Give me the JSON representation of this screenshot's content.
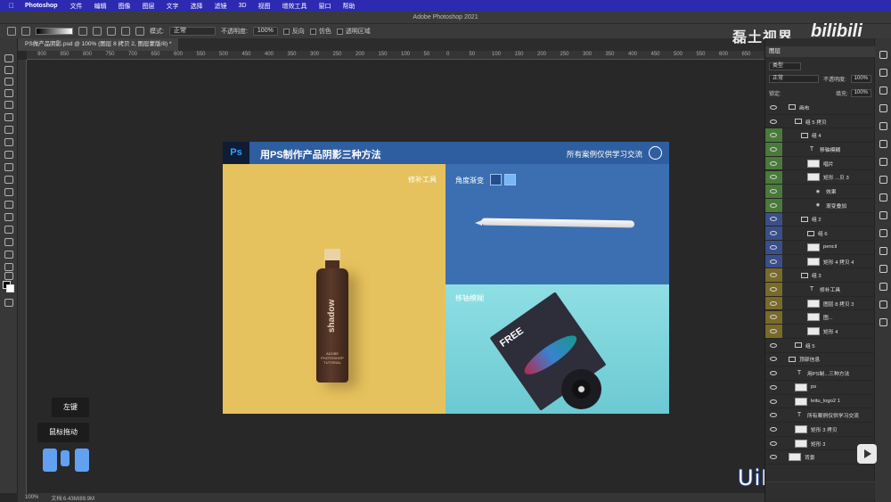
{
  "menubar": {
    "app": "Photoshop",
    "items": [
      "文件",
      "编辑",
      "图像",
      "图层",
      "文字",
      "选择",
      "滤镜",
      "3D",
      "视图",
      "增效工具",
      "窗口",
      "帮助"
    ]
  },
  "titlebar": {
    "title": "Adobe Photoshop 2021"
  },
  "options": {
    "mode_label": "模式:",
    "mode_value": "正常",
    "opacity_label": "不透明度:",
    "opacity_value": "100%",
    "reverse_label": "反向",
    "dither_label": "仿色",
    "transparency_label": "透明区域"
  },
  "document": {
    "tab": "PS做产品阴影.psd @ 100% (图层 8 拷贝 2, 图层蒙版/8) *"
  },
  "ruler": [
    "900",
    "850",
    "800",
    "750",
    "700",
    "650",
    "600",
    "550",
    "500",
    "450",
    "400",
    "350",
    "300",
    "250",
    "200",
    "150",
    "100",
    "50",
    "0",
    "50",
    "100",
    "150",
    "200",
    "250",
    "300",
    "350",
    "400",
    "450",
    "500",
    "550",
    "600",
    "650",
    "700",
    "750",
    "800"
  ],
  "artwork": {
    "ps_badge": "Ps",
    "title": "用PS制作产品阴影三种方法",
    "note": "所有案例仅供学习交流",
    "panel_left_label": "修补工具",
    "panel_right_top_label": "角度渐变",
    "panel_right_bottom_label": "移轴模糊",
    "bottle_text": "shadow",
    "bottle_small": "ADOBE PHOTOSHOP TUTORIAL",
    "cd_text": "FREE",
    "colors": {
      "header": "#2f5ea0",
      "left": "#e6c25e",
      "right_top": "#3c6fb2",
      "right_bottom": "#8edfe4"
    }
  },
  "overlay": {
    "key_label": "左键",
    "drag_label": "鼠标拖动"
  },
  "statusbar": {
    "zoom": "100%",
    "doc": "文档:6.43M/89.9M"
  },
  "watermarks": {
    "channel": "磊土视界",
    "bili": "bilibili",
    "site": "UiBQ.CoM"
  },
  "layers_panel": {
    "title": "图层",
    "filter": "类型",
    "blend": "正常",
    "opacity_label": "不透明度:",
    "opacity": "100%",
    "lock_label": "锁定:",
    "fill_label": "填充:",
    "fill": "100%",
    "items": [
      {
        "name": "画布",
        "kind": "group",
        "indent": 0,
        "color": ""
      },
      {
        "name": "组 5 拷贝",
        "kind": "group",
        "indent": 1,
        "color": ""
      },
      {
        "name": "组 4",
        "kind": "group",
        "indent": 2,
        "color": "#4a7a3a"
      },
      {
        "name": "移轴模糊",
        "kind": "text",
        "indent": 3,
        "color": "#4a7a3a"
      },
      {
        "name": "唱片",
        "kind": "thumb",
        "indent": 3,
        "color": "#4a7a3a"
      },
      {
        "name": "矩形 ...贝 3",
        "kind": "thumb",
        "indent": 3,
        "color": "#4a7a3a"
      },
      {
        "name": "效果",
        "kind": "fx",
        "indent": 4,
        "color": "#4a7a3a"
      },
      {
        "name": "渐变叠加",
        "kind": "fx",
        "indent": 4,
        "color": "#4a7a3a"
      },
      {
        "name": "组 2",
        "kind": "group",
        "indent": 2,
        "color": "#3a4f8a"
      },
      {
        "name": "组 6",
        "kind": "group",
        "indent": 3,
        "color": "#3a4f8a"
      },
      {
        "name": "pencil",
        "kind": "thumb",
        "indent": 3,
        "color": "#3a4f8a"
      },
      {
        "name": "矩形 4 拷贝 4",
        "kind": "thumb",
        "indent": 3,
        "color": "#3a4f8a"
      },
      {
        "name": "组 3",
        "kind": "group",
        "indent": 2,
        "color": "#7a6a2a"
      },
      {
        "name": "修补工具",
        "kind": "text",
        "indent": 3,
        "color": "#7a6a2a"
      },
      {
        "name": "图层 8 拷贝 3",
        "kind": "thumb",
        "indent": 3,
        "color": "#7a6a2a"
      },
      {
        "name": "图...",
        "kind": "thumb",
        "indent": 3,
        "color": "#7a6a2a"
      },
      {
        "name": "矩形 4",
        "kind": "thumb",
        "indent": 3,
        "color": "#7a6a2a"
      },
      {
        "name": "组 5",
        "kind": "group",
        "indent": 1,
        "color": ""
      },
      {
        "name": "顶部信息",
        "kind": "group",
        "indent": 0,
        "color": ""
      },
      {
        "name": "用PS制...三种方法",
        "kind": "text",
        "indent": 1,
        "color": ""
      },
      {
        "name": "ps",
        "kind": "thumb",
        "indent": 1,
        "color": ""
      },
      {
        "name": "leitu_logo2 1",
        "kind": "thumb",
        "indent": 1,
        "color": ""
      },
      {
        "name": "所有案例仅供学习交流",
        "kind": "text",
        "indent": 1,
        "color": ""
      },
      {
        "name": "矩形 3 拷贝",
        "kind": "thumb",
        "indent": 1,
        "color": ""
      },
      {
        "name": "矩形 3",
        "kind": "thumb",
        "indent": 1,
        "color": ""
      },
      {
        "name": "背景",
        "kind": "thumb",
        "indent": 0,
        "color": ""
      }
    ]
  }
}
